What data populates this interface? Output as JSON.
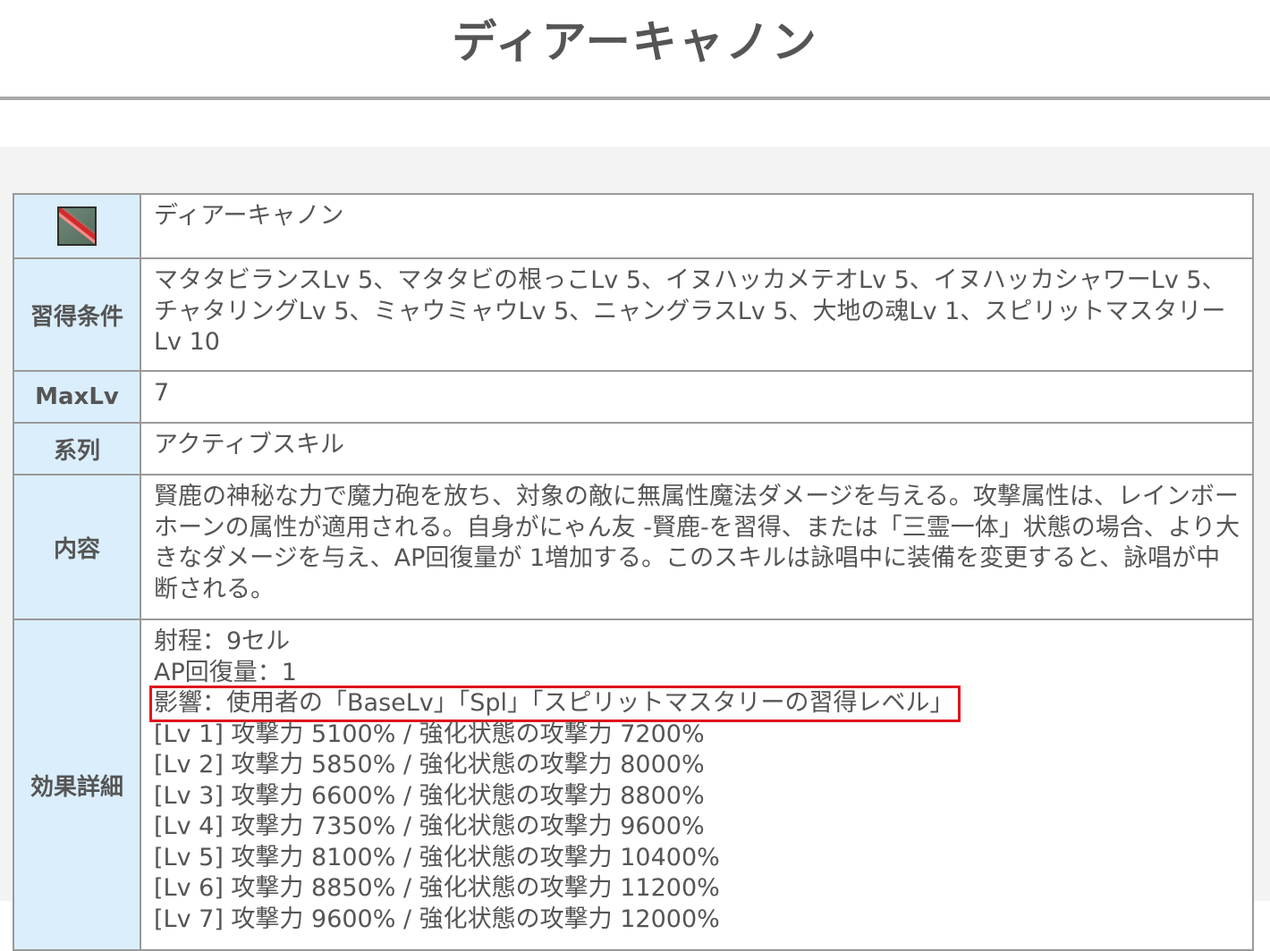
{
  "page": {
    "title": "ディアーキャノン"
  },
  "skill": {
    "icon": "deer-cannon-skill-icon",
    "name": "ディアーキャノン",
    "requirements_label": "習得条件",
    "requirements": "マタタビランスLv 5、マタタビの根っこLv 5、イヌハッカメテオLv 5、イヌハッカシャワーLv 5、チャタリングLv 5、ミャウミャウLv 5、ニャングラスLv 5、大地の魂Lv 1、スピリットマスタリーLv 10",
    "maxlv_label": "MaxLv",
    "maxlv": "7",
    "series_label": "系列",
    "series": "アクティブスキル",
    "description_label": "内容",
    "description": "賢鹿の神秘な力で魔力砲を放ち、対象の敵に無属性魔法ダメージを与える。攻撃属性は、レインボーホーンの属性が適用される。自身がにゃん友 -賢鹿-を習得、または「三霊一体」状態の場合、より大きなダメージを与え、AP回復量が 1増加する。このスキルは詠唱中に装備を変更すると、詠唱が中断される。",
    "effect_label": "効果詳細",
    "effect_lines": [
      "射程：9セル",
      "AP回復量：1",
      "影響：使用者の「BaseLv」「Spl」「スピリットマスタリーの習得レベル」",
      "[Lv 1] 攻撃力 5100% / 強化状態の攻撃力 7200%",
      "[Lv 2] 攻撃力 5850% / 強化状態の攻撃力 8000%",
      "[Lv 3] 攻撃力 6600% / 強化状態の攻撃力 8800%",
      "[Lv 4] 攻撃力 7350% / 強化状態の攻撃力 9600%",
      "[Lv 5] 攻撃力 8100% / 強化状態の攻撃力 10400%",
      "[Lv 6] 攻撃力 8850% / 強化状態の攻撃力 11200%",
      "[Lv 7] 攻撃力 9600% / 強化状態の攻撃力 12000%"
    ]
  },
  "colors": {
    "header_cell_bg": "#dbeefb",
    "border": "#9a9a9a",
    "text": "#555555",
    "highlight_box": "#e0141e",
    "background": "#f3f3f3"
  }
}
